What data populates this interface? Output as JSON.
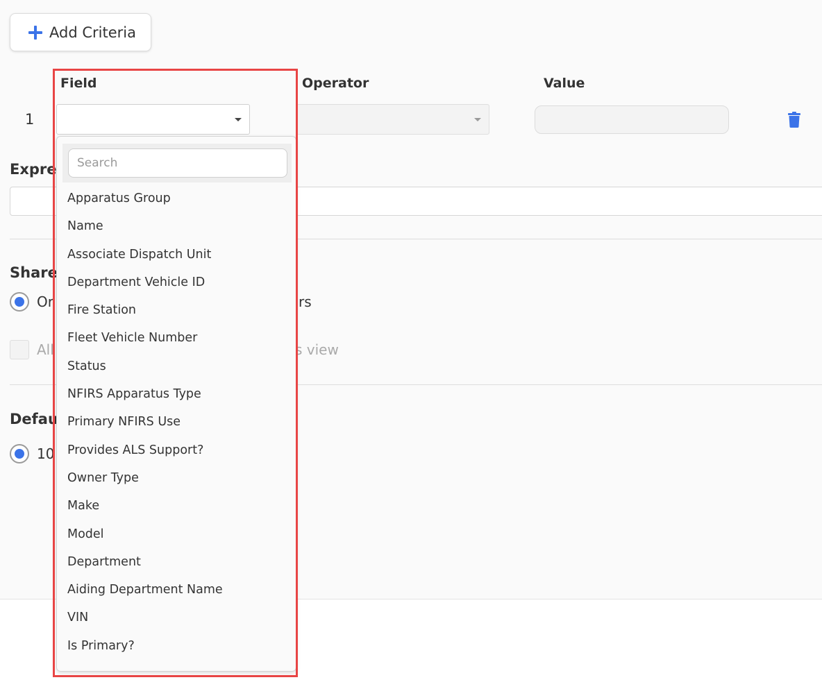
{
  "toolbar": {
    "add_criteria_label": "Add Criteria"
  },
  "criteria": {
    "headers": {
      "field": "Field",
      "operator": "Operator",
      "value": "Value"
    },
    "rows": [
      {
        "number": "1",
        "field_value": "",
        "operator_value": "",
        "value": ""
      }
    ]
  },
  "sections": {
    "expression_title_visible": "Expre",
    "share_title_visible": "Share",
    "share_option_prefix": "Or",
    "share_option_suffix": "rs",
    "allow_prefix": "All",
    "allow_suffix": "s view",
    "default_title_visible": "Defau",
    "default_option_prefix": "10"
  },
  "dropdown": {
    "search_placeholder": "Search",
    "options": [
      "Apparatus Group",
      "Name",
      "Associate Dispatch Unit",
      "Department Vehicle ID",
      "Fire Station",
      "Fleet Vehicle Number",
      "Status",
      "NFIRS Apparatus Type",
      "Primary NFIRS Use",
      "Provides ALS Support?",
      "Owner Type",
      "Make",
      "Model",
      "Department",
      "Aiding Department Name",
      "VIN",
      "Is Primary?"
    ]
  },
  "colors": {
    "accent": "#3b73e8",
    "highlight": "#e84545"
  },
  "icons": {
    "add": "plus-icon",
    "delete": "trash-icon",
    "caret": "chevron-down-icon"
  }
}
